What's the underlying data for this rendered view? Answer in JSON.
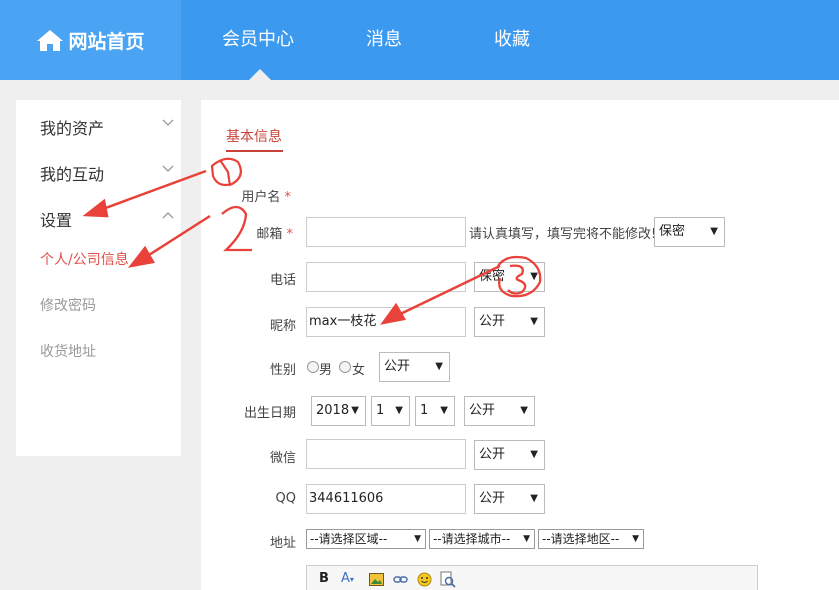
{
  "nav": {
    "home": "网站首页",
    "member_center": "会员中心",
    "messages": "消息",
    "favorites": "收藏"
  },
  "sidebar": {
    "items": [
      {
        "label": "我的资产"
      },
      {
        "label": "我的互动"
      },
      {
        "label": "设置"
      }
    ],
    "sub_items": [
      {
        "label": "个人/公司信息",
        "active": true
      },
      {
        "label": "修改密码"
      },
      {
        "label": "收货地址"
      }
    ]
  },
  "form": {
    "tab": "基本信息",
    "username_label": "用户名",
    "email_label": "邮箱",
    "email_value": "",
    "email_note": "请认真填写，填写完将不能修改!",
    "email_privacy": "保密",
    "phone_label": "电话",
    "phone_value": "",
    "phone_privacy": "保密",
    "nickname_label": "昵称",
    "nickname_value": "max一枝花",
    "nickname_privacy": "公开",
    "gender_label": "性别",
    "gender_male": "男",
    "gender_female": "女",
    "gender_privacy": "公开",
    "birthday_label": "出生日期",
    "birth_year": "2018",
    "birth_month": "1",
    "birth_day": "1",
    "birthday_privacy": "公开",
    "wechat_label": "微信",
    "wechat_value": "",
    "wechat_privacy": "公开",
    "qq_label": "QQ",
    "qq_value": "344611606",
    "qq_privacy": "公开",
    "address_label": "地址",
    "region_placeholder": "--请选择区域--",
    "city_placeholder": "--请选择城市--",
    "district_placeholder": "--请选择地区--",
    "required_mark": "*"
  },
  "editor_toolbar": {
    "bold": "B",
    "font_color": "A"
  },
  "colors": {
    "nav_bg": "#3b99f0",
    "accent_red": "#e0524a"
  }
}
